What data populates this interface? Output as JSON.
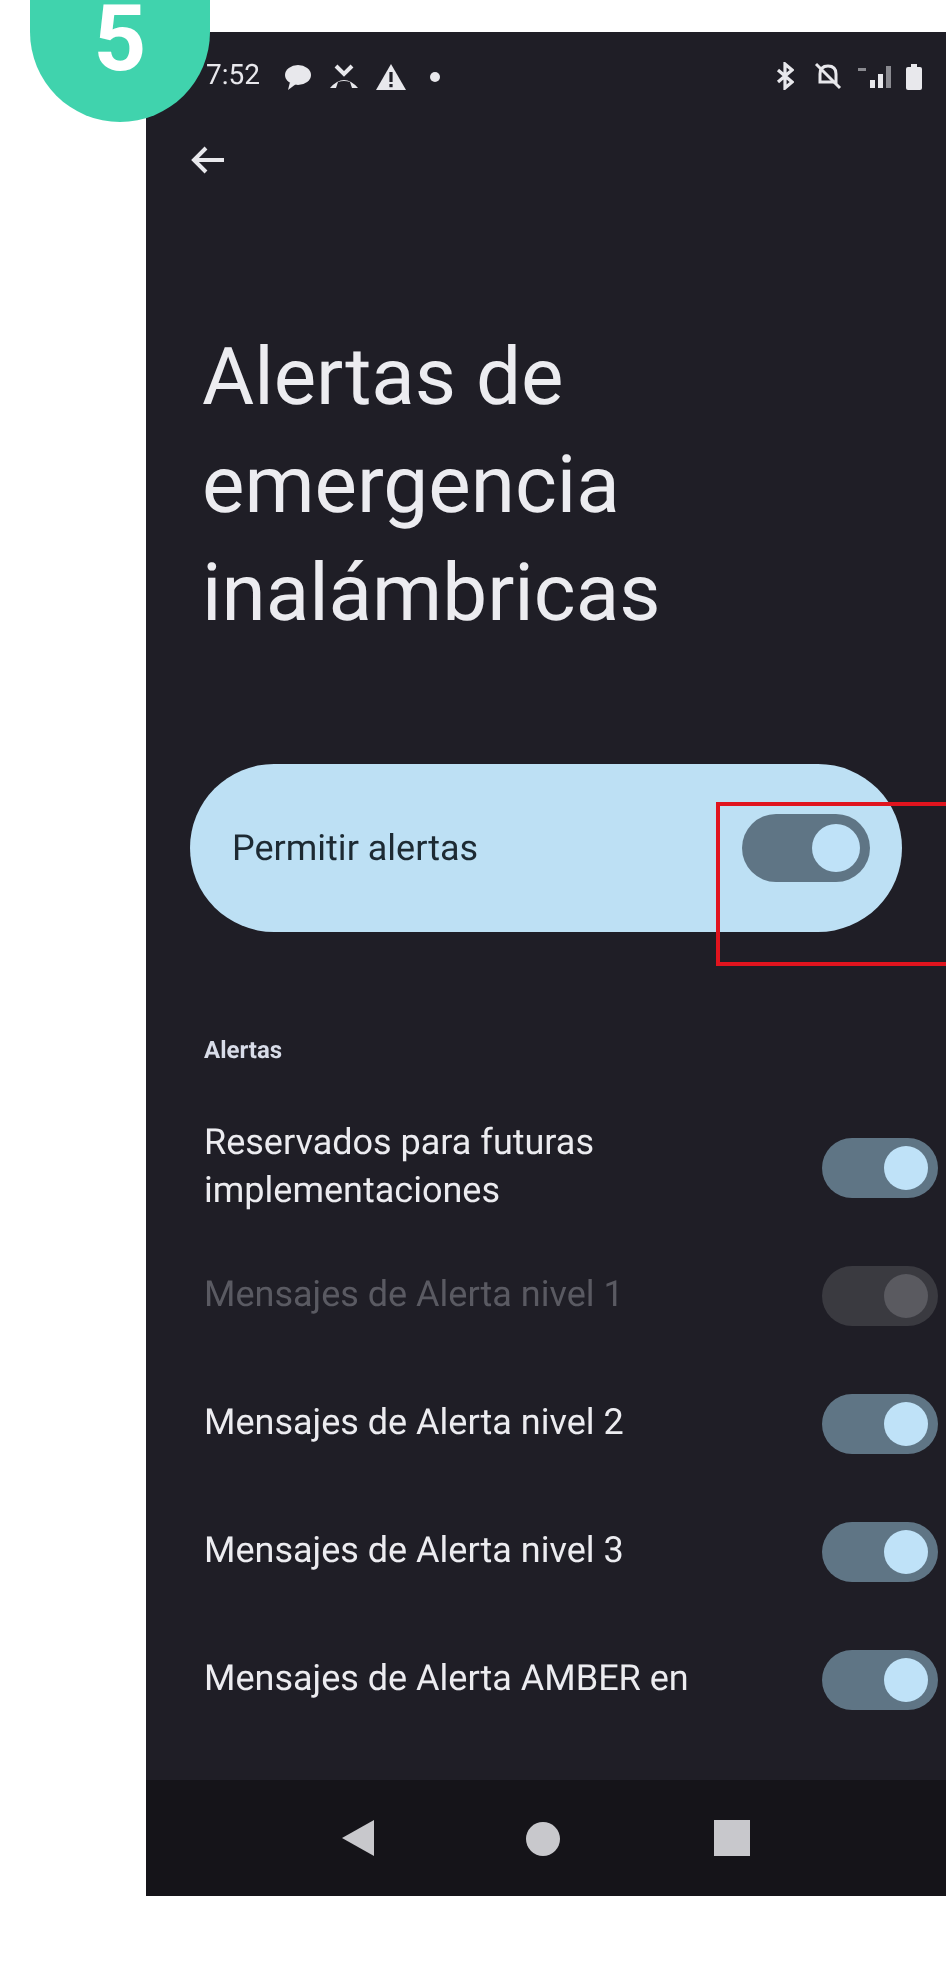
{
  "step_badge": "5",
  "status_bar": {
    "time": "7:52"
  },
  "title": "Alertas de emergencia inalámbricas",
  "main_switch": {
    "label": "Permitir alertas",
    "on": true,
    "highlighted": true
  },
  "section": {
    "header": "Alertas",
    "items": [
      {
        "label": "Reservados para futuras implementaciones",
        "on": true,
        "disabled": false
      },
      {
        "label": "Mensajes de Alerta nivel 1",
        "on": true,
        "disabled": true
      },
      {
        "label": "Mensajes de Alerta nivel 2",
        "on": true,
        "disabled": false
      },
      {
        "label": "Mensajes de Alerta nivel 3",
        "on": true,
        "disabled": false
      },
      {
        "label": "Mensajes de Alerta AMBER en",
        "on": true,
        "disabled": false
      }
    ]
  }
}
